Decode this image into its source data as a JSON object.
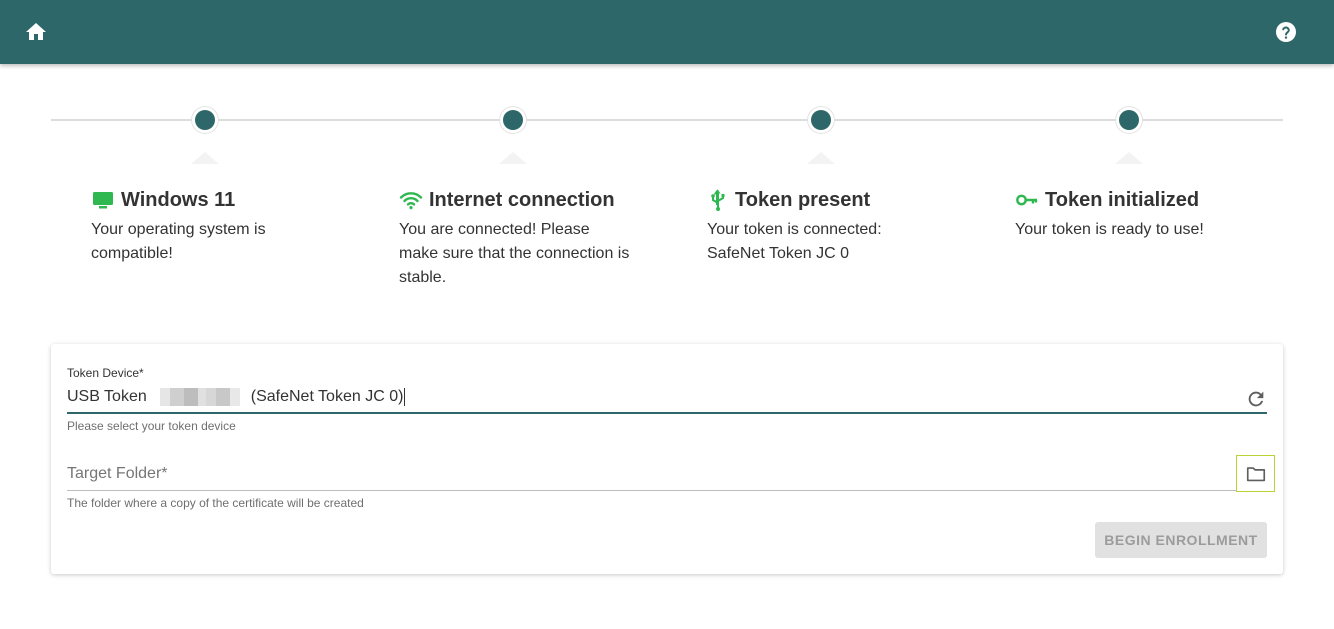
{
  "colors": {
    "brand": "#2d6769",
    "icon_green": "#2fb84f",
    "focus_outline": "#b7d334",
    "disabled_button_bg": "#e1e1e1"
  },
  "topbar": {
    "home_icon": "home-icon",
    "help_icon": "help-circle-icon"
  },
  "steps": [
    {
      "icon": "monitor-icon",
      "title": "Windows 11",
      "description": "Your operating system is compatible!"
    },
    {
      "icon": "wifi-icon",
      "title": "Internet connection",
      "description": "You are connected! Please make sure that the connection is stable."
    },
    {
      "icon": "usb-icon",
      "title": "Token present",
      "description": "Your token is connected: SafeNet Token JC 0"
    },
    {
      "icon": "key-icon",
      "title": "Token initialized",
      "description": "Your token is ready to use!"
    }
  ],
  "form": {
    "token_device": {
      "label": "Token Device*",
      "value_prefix": "USB Token",
      "value_suffix": "(SafeNet Token JC 0)",
      "hint": "Please select your token device",
      "refresh_icon": "refresh-icon"
    },
    "target_folder": {
      "placeholder": "Target Folder*",
      "hint": "The folder where a copy of the certificate will be created",
      "folder_icon": "folder-icon"
    },
    "begin_button": "BEGIN ENROLLMENT"
  }
}
